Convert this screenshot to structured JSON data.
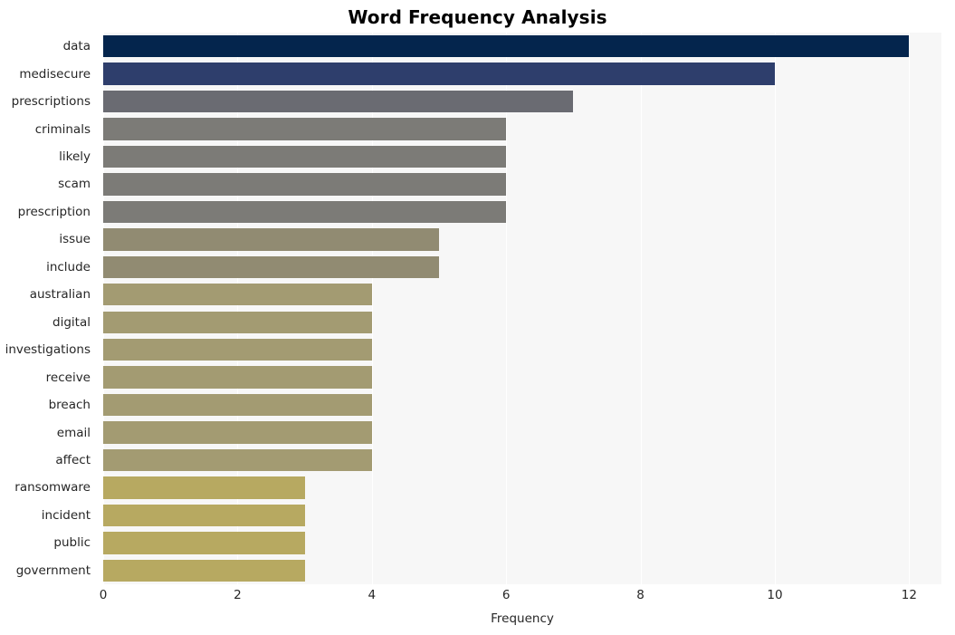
{
  "chart_data": {
    "type": "bar",
    "orientation": "horizontal",
    "title": "Word Frequency Analysis",
    "xlabel": "Frequency",
    "ylabel": "",
    "xlim": [
      0,
      12.48
    ],
    "xticks": [
      0,
      2,
      4,
      6,
      8,
      10,
      12
    ],
    "xtick_labels": [
      "0",
      "2",
      "4",
      "6",
      "8",
      "10",
      "12"
    ],
    "grid": true,
    "legend": null,
    "categories": [
      "data",
      "mediseсure",
      "prescriptions",
      "criminals",
      "likely",
      "scam",
      "prescription",
      "issue",
      "include",
      "australian",
      "digital",
      "investigations",
      "receive",
      "breach",
      "email",
      "affect",
      "ransomware",
      "incident",
      "public",
      "government"
    ],
    "values": [
      12,
      10,
      7,
      6,
      6,
      6,
      6,
      5,
      5,
      4,
      4,
      4,
      4,
      4,
      4,
      4,
      3,
      3,
      3,
      3
    ],
    "bar_colors": [
      "#04254d",
      "#2e3e6c",
      "#6a6b72",
      "#7c7b77",
      "#7c7b77",
      "#7c7b77",
      "#7c7b77",
      "#918b72",
      "#918b72",
      "#a39b72",
      "#a39b72",
      "#a39b72",
      "#a39b72",
      "#a39b72",
      "#a39b72",
      "#a39b72",
      "#b7a961",
      "#b7a961",
      "#b7a961",
      "#b7a961"
    ],
    "plot_background": "#f7f7f7",
    "gridline_color": "#ffffff",
    "figure_background": "#ffffff",
    "text_color": "#262626"
  }
}
